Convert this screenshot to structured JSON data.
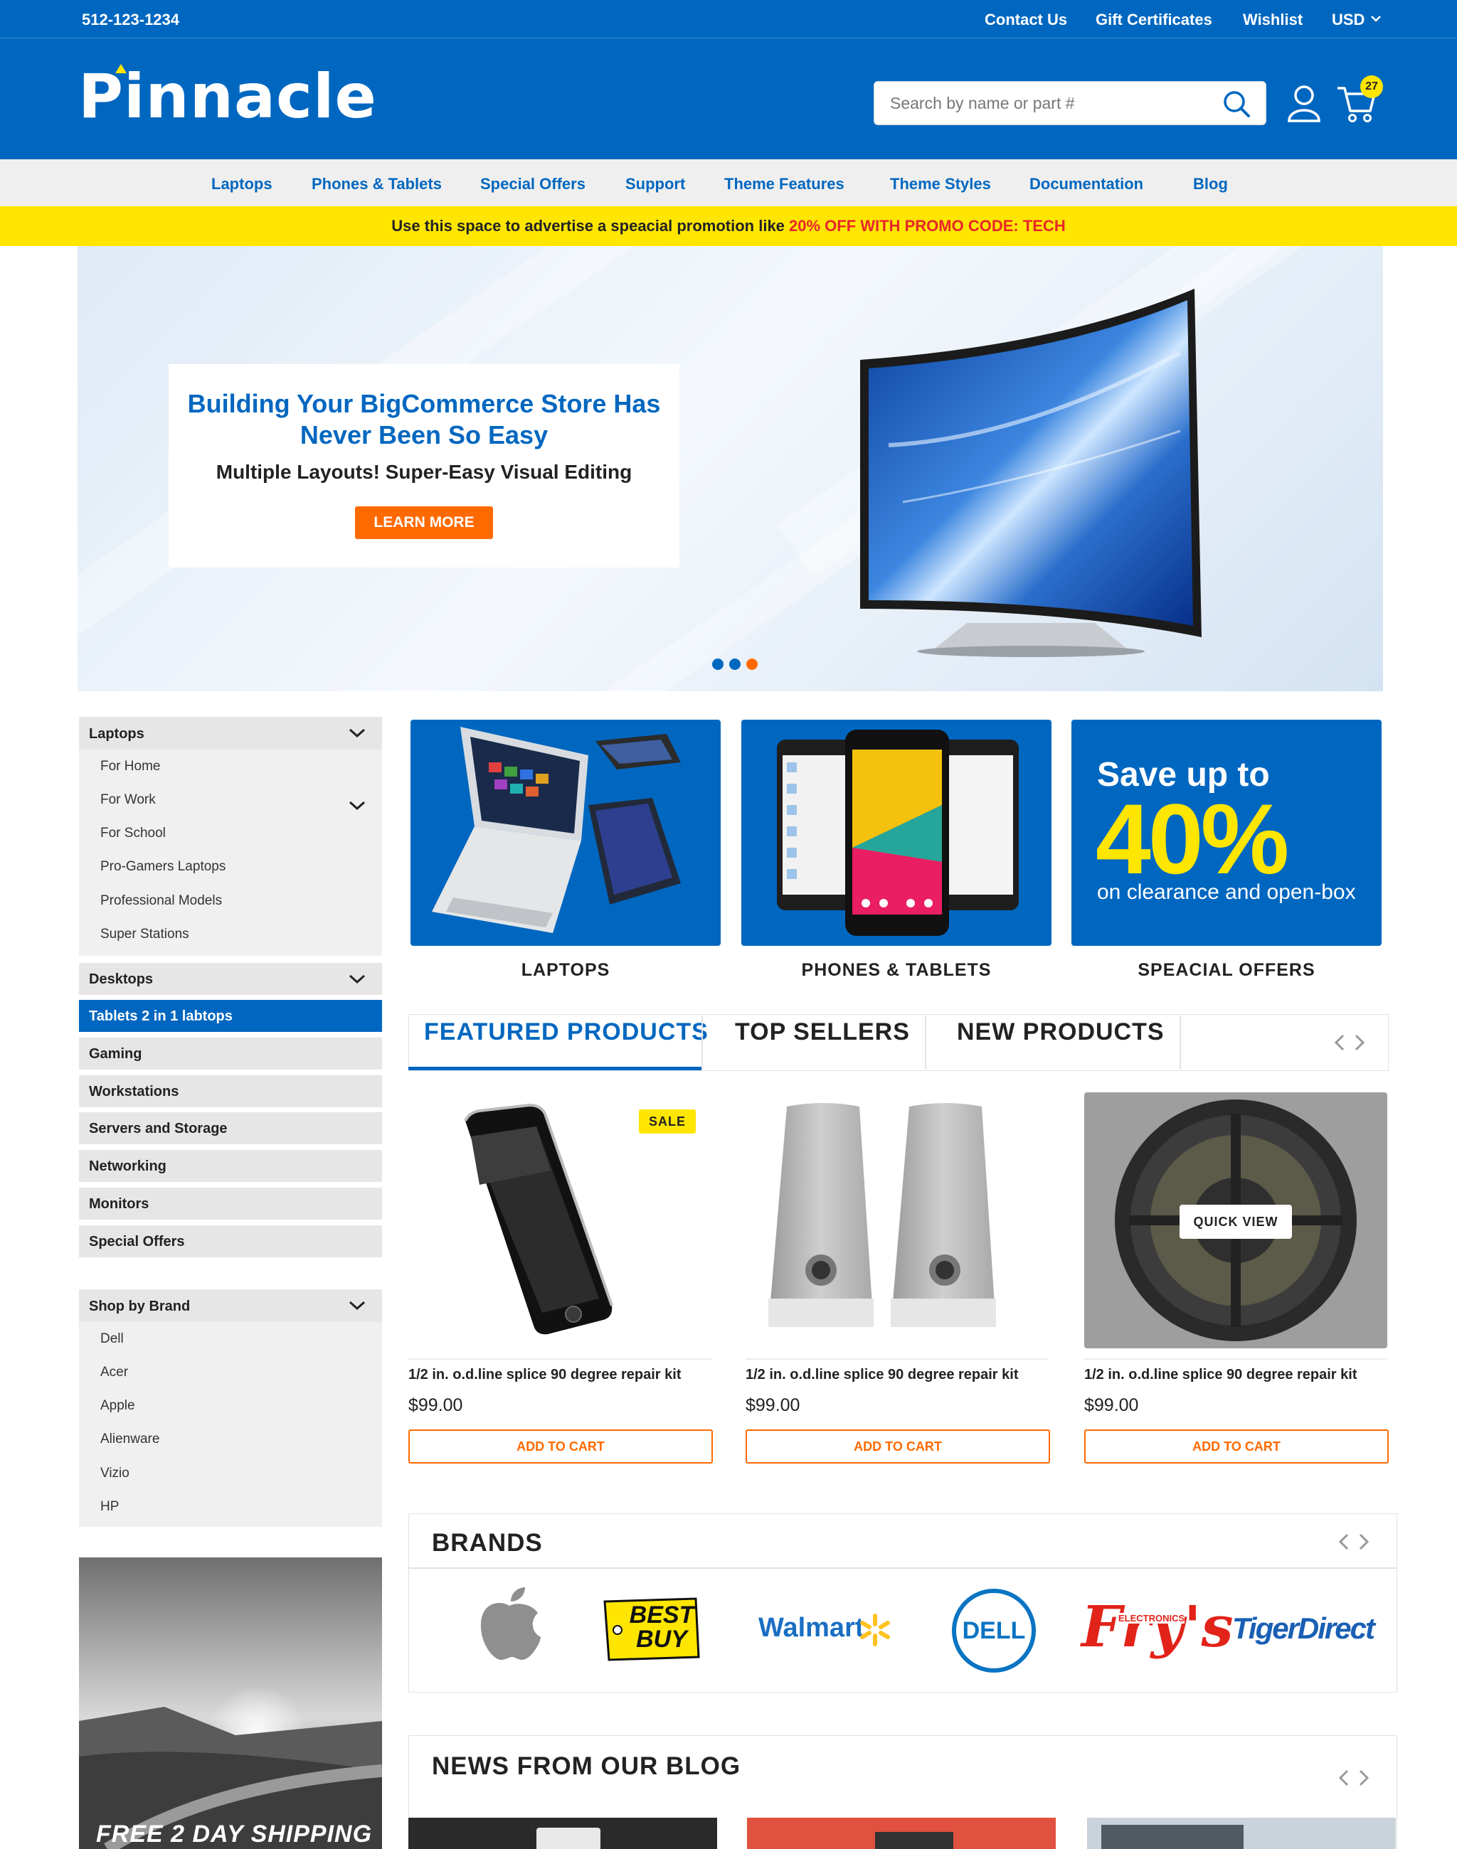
{
  "topbar": {
    "phone": "512-123-1234",
    "links": [
      "Contact Us",
      "Gift Certificates",
      "Wishlist"
    ],
    "currency": "USD"
  },
  "header": {
    "logo": "Pinnacle",
    "search_placeholder": "Search by name or part #",
    "cart_count": "27"
  },
  "nav": [
    "Laptops",
    "Phones & Tablets",
    "Special Offers",
    "Support",
    "Theme Features",
    "Theme Styles",
    "Documentation",
    "Blog"
  ],
  "promo": {
    "text": "Use this space to advertise a speacial promotion like ",
    "code": "20% OFF WITH PROMO CODE: TECH"
  },
  "hero": {
    "title_line1": "Building Your BigCommerce Store Has",
    "title_line2": "Never Been So Easy",
    "subtitle": "Multiple Layouts! Super-Easy Visual Editing",
    "button": "LEARN MORE",
    "active_slide": 3
  },
  "sidebar": {
    "laptops": {
      "label": "Laptops",
      "items": [
        "For Home",
        "For Work",
        "For School",
        "Pro-Gamers Laptops",
        "Professional Models",
        "Super Stations"
      ]
    },
    "categories": [
      "Desktops",
      "Tablets 2 in 1  labtops",
      "Gaming",
      "Workstations",
      "Servers and Storage",
      "Networking",
      "Monitors",
      "Special Offers"
    ],
    "brands": {
      "label": "Shop by Brand",
      "items": [
        "Dell",
        "Acer",
        "Apple",
        "Alienware",
        "Vizio",
        "HP"
      ]
    },
    "shipping_banner": "FREE 2 DAY SHIPPING"
  },
  "tiles": {
    "laptops": "LAPTOPS",
    "phones": "PHONES & TABLETS",
    "offers": "SPEACIAL OFFERS",
    "offer_line1": "Save up to",
    "offer_big": "40%",
    "offer_line2": "on clearance and open-box"
  },
  "tabs": [
    "FEATURED PRODUCTS",
    "TOP SELLERS",
    "NEW PRODUCTS"
  ],
  "products": [
    {
      "name": "1/2 in. o.d.line splice 90 degree repair kit",
      "price": "$99.00",
      "button": "ADD TO CART",
      "badge": "SALE"
    },
    {
      "name": "1/2 in. o.d.line splice 90 degree repair kit",
      "price": "$99.00",
      "button": "ADD TO CART"
    },
    {
      "name": "1/2 in. o.d.line splice 90 degree repair kit",
      "price": "$99.00",
      "button": "ADD TO CART",
      "overlay": "QUICK VIEW"
    }
  ],
  "brands": {
    "title": "BRANDS",
    "logos": [
      "Apple",
      "BEST BUY",
      "Walmart",
      "DELL",
      "Fry's",
      "TigerDirect"
    ],
    "frys_small": "ELECTRONICS"
  },
  "blog": {
    "title": "NEWS FROM OUR BLOG"
  },
  "colors": {
    "primary": "#0067c0",
    "accent": "#ff6a00",
    "promo": "#ffe600",
    "promo_code": "#e8262b"
  }
}
